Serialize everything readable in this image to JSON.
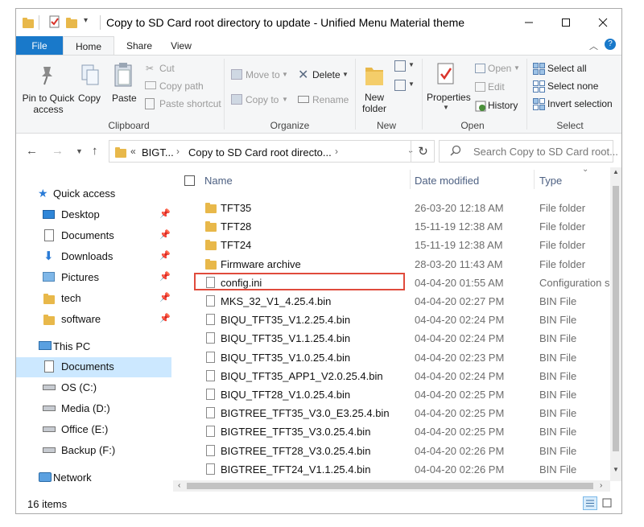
{
  "window": {
    "title": "Copy to SD Card root directory to update - Unified Menu Material theme"
  },
  "tabs": [
    "File",
    "Home",
    "Share",
    "View"
  ],
  "ribbon": {
    "clipboard": {
      "label": "Clipboard",
      "pin": [
        "Pin to Quick",
        "access"
      ],
      "copy": "Copy",
      "paste": "Paste",
      "cut": "Cut",
      "copy_path": "Copy path",
      "paste_shortcut": "Paste shortcut"
    },
    "organize": {
      "label": "Organize",
      "move_to": "Move to",
      "copy_to": "Copy to",
      "delete": "Delete",
      "rename": "Rename"
    },
    "new": {
      "label": "New",
      "new_folder": [
        "New",
        "folder"
      ]
    },
    "open": {
      "label": "Open",
      "properties": "Properties",
      "open": "Open",
      "edit": "Edit",
      "history": "History"
    },
    "select": {
      "label": "Select",
      "select_all": "Select all",
      "select_none": "Select none",
      "invert": "Invert selection"
    }
  },
  "address": {
    "crumbs": [
      "BIGT...",
      "Copy to SD Card root directo..."
    ],
    "search_placeholder": "Search Copy to SD Card root..."
  },
  "nav": {
    "quick_access": "Quick access",
    "quick_items": [
      {
        "label": "Desktop"
      },
      {
        "label": "Documents"
      },
      {
        "label": "Downloads"
      },
      {
        "label": "Pictures"
      },
      {
        "label": "tech"
      },
      {
        "label": "software"
      }
    ],
    "this_pc": "This PC",
    "pc_items": [
      {
        "label": "Documents"
      },
      {
        "label": "OS (C:)"
      },
      {
        "label": "Media (D:)"
      },
      {
        "label": "Office (E:)"
      },
      {
        "label": "Backup (F:)"
      }
    ],
    "network": "Network"
  },
  "columns": {
    "name": "Name",
    "date": "Date modified",
    "type": "Type"
  },
  "files": [
    {
      "name": "TFT35",
      "date": "26-03-20 12:18 AM",
      "type": "File folder"
    },
    {
      "name": "TFT28",
      "date": "15-11-19 12:38 AM",
      "type": "File folder"
    },
    {
      "name": "TFT24",
      "date": "15-11-19 12:38 AM",
      "type": "File folder"
    },
    {
      "name": "Firmware archive",
      "date": "28-03-20 11:43 AM",
      "type": "File folder"
    },
    {
      "name": "config.ini",
      "date": "04-04-20 01:55 AM",
      "type": "Configuration s"
    },
    {
      "name": "MKS_32_V1_4.25.4.bin",
      "date": "04-04-20 02:27 PM",
      "type": "BIN File"
    },
    {
      "name": "BIQU_TFT35_V1.2.25.4.bin",
      "date": "04-04-20 02:24 PM",
      "type": "BIN File"
    },
    {
      "name": "BIQU_TFT35_V1.1.25.4.bin",
      "date": "04-04-20 02:24 PM",
      "type": "BIN File"
    },
    {
      "name": "BIQU_TFT35_V1.0.25.4.bin",
      "date": "04-04-20 02:23 PM",
      "type": "BIN File"
    },
    {
      "name": "BIQU_TFT35_APP1_V2.0.25.4.bin",
      "date": "04-04-20 02:24 PM",
      "type": "BIN File"
    },
    {
      "name": "BIQU_TFT28_V1.0.25.4.bin",
      "date": "04-04-20 02:25 PM",
      "type": "BIN File"
    },
    {
      "name": "BIGTREE_TFT35_V3.0_E3.25.4.bin",
      "date": "04-04-20 02:25 PM",
      "type": "BIN File"
    },
    {
      "name": "BIGTREE_TFT35_V3.0.25.4.bin",
      "date": "04-04-20 02:25 PM",
      "type": "BIN File"
    },
    {
      "name": "BIGTREE_TFT28_V3.0.25.4.bin",
      "date": "04-04-20 02:26 PM",
      "type": "BIN File"
    },
    {
      "name": "BIGTREE_TFT24_V1.1.25.4.bin",
      "date": "04-04-20 02:26 PM",
      "type": "BIN File"
    }
  ],
  "status": {
    "count": "16 items"
  },
  "colors": {
    "accent": "#1979ca",
    "highlight": "#e04b3c",
    "selection": "#cce8ff",
    "folder": "#e8b84a"
  }
}
